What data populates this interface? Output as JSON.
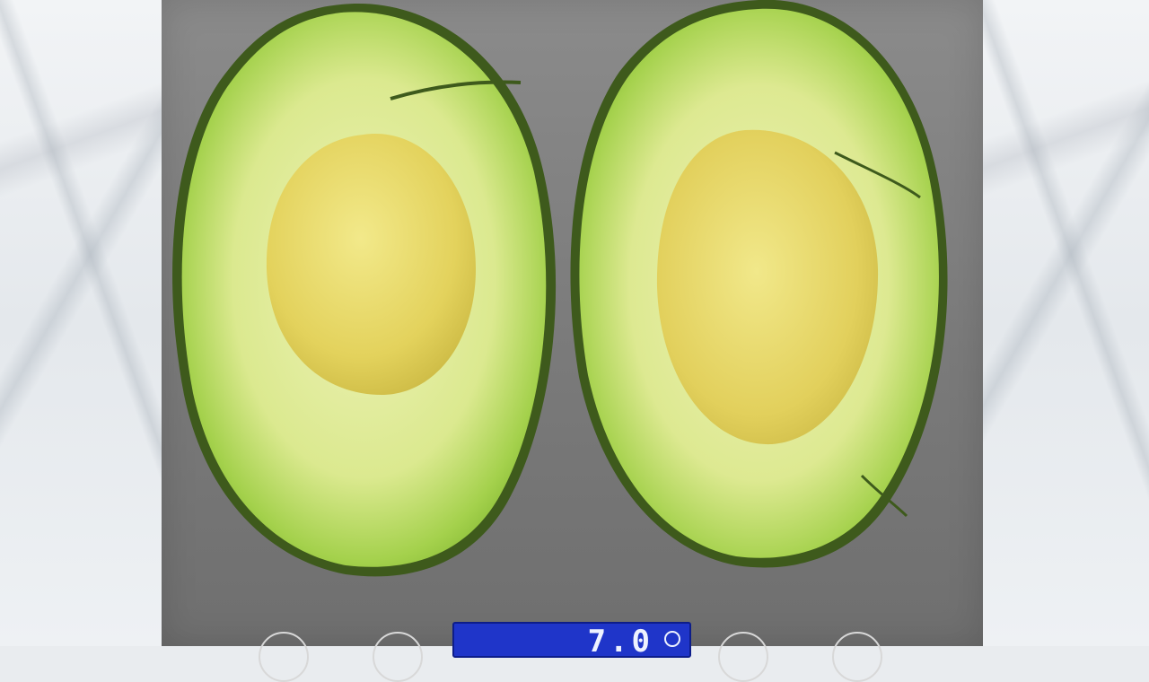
{
  "scene": {
    "description_kind": "photo",
    "colors": {
      "avocado_skin": "#3e5a1c",
      "avocado_flesh_outer": "#8cc43a",
      "avocado_flesh_inner": "#e4eb9c",
      "pit_cavity": "#e6d86a",
      "scale_plate": "#7e7e7e",
      "display": "#1f35c9"
    }
  },
  "scale": {
    "display_reading": "7.0",
    "buttons": [
      "power-button",
      "mode-button",
      "tare-button",
      "unit-button"
    ]
  }
}
